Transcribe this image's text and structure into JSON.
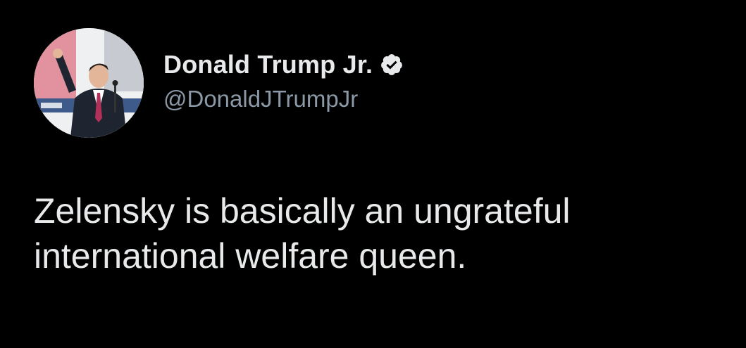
{
  "author": {
    "display_name": "Donald Trump Jr.",
    "handle": "@DonaldJTrumpJr",
    "verified": true,
    "avatar_icon": "profile-photo"
  },
  "tweet": {
    "text": "Zelensky is basically an ungrateful international welfare queen."
  },
  "colors": {
    "background": "#000000",
    "primary_text": "#e7e9ea",
    "secondary_text": "#8b98a5",
    "verified_badge": "#e7e9ea"
  }
}
